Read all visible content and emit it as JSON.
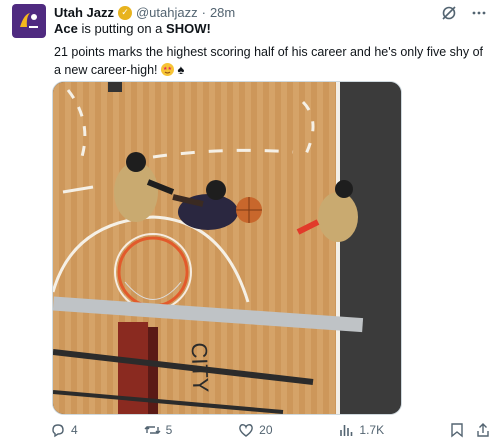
{
  "tweet": {
    "author_name": "Utah Jazz",
    "handle": "@utahjazz",
    "separator": "·",
    "time": "28m",
    "line1_bold": "Ace",
    "line1_rest": " is putting on a ",
    "line1_show": "SHOW!",
    "body": "21 points marks the highest scoring half of his career and he's only five shy of a new career-high!"
  },
  "metrics": {
    "replies": "4",
    "reposts": "5",
    "likes": "20",
    "views": "1.7K"
  },
  "media": {
    "description": "overhead view of basketball player driving to the hoop",
    "court_text": "CITY"
  },
  "colors": {
    "brand": "#4f2a80",
    "verified": "#e8b31e",
    "muted": "#536471"
  },
  "icons": [
    "jazz-logo-icon",
    "verified-badge-icon",
    "grok-icon",
    "more-icon",
    "reply-icon",
    "repost-icon",
    "like-icon",
    "views-icon",
    "bookmark-icon",
    "share-icon"
  ]
}
